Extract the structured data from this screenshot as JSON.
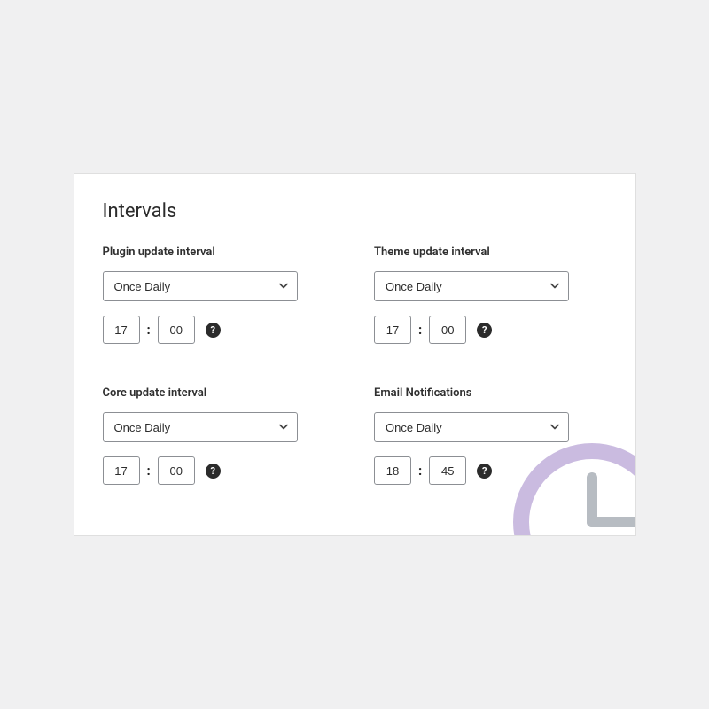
{
  "panel": {
    "title": "Intervals"
  },
  "fields": {
    "plugin": {
      "label": "Plugin update interval",
      "select": "Once Daily",
      "hour": "17",
      "minute": "00"
    },
    "theme": {
      "label": "Theme update interval",
      "select": "Once Daily",
      "hour": "17",
      "minute": "00"
    },
    "core": {
      "label": "Core update interval",
      "select": "Once Daily",
      "hour": "17",
      "minute": "00"
    },
    "email": {
      "label": "Email Notifications",
      "select": "Once Daily",
      "hour": "18",
      "minute": "45"
    }
  },
  "help_glyph": "?"
}
